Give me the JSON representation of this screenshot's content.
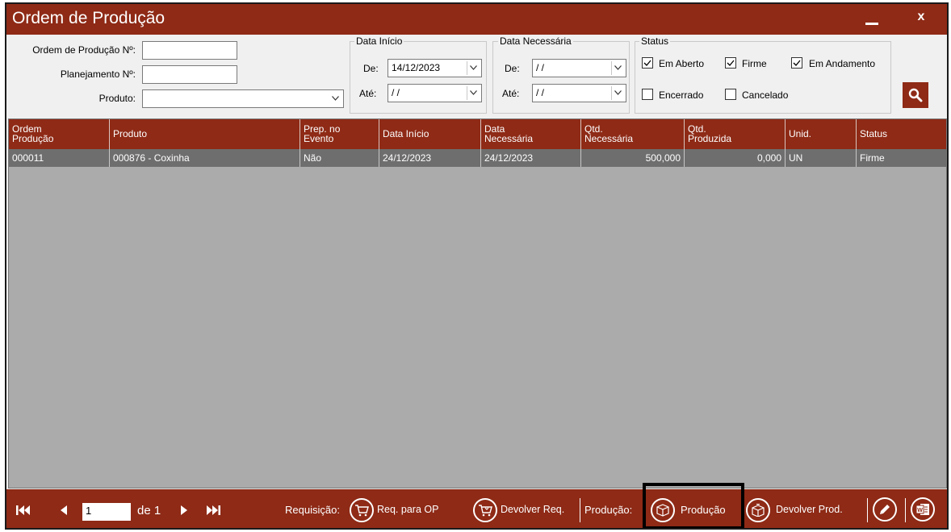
{
  "window": {
    "title": "Ordem de Produção",
    "minimize_label": "_",
    "close_label": "x"
  },
  "filters": {
    "ordem_label": "Ordem de Produção Nº:",
    "ordem_value": "",
    "planejamento_label": "Planejamento Nº:",
    "planejamento_value": "",
    "produto_label": "Produto:",
    "produto_value": "",
    "data_inicio": {
      "legend": "Data Início",
      "de_label": "De:",
      "de_value": "14/12/2023",
      "ate_label": "Até:",
      "ate_value": " / /"
    },
    "data_necessaria": {
      "legend": "Data Necessária",
      "de_label": "De:",
      "de_value": " / /",
      "ate_label": "Até:",
      "ate_value": " / /"
    },
    "status": {
      "legend": "Status",
      "options": [
        {
          "label": "Em Aberto",
          "checked": true
        },
        {
          "label": "Firme",
          "checked": true
        },
        {
          "label": "Em Andamento",
          "checked": true
        },
        {
          "label": "Encerrado",
          "checked": false
        },
        {
          "label": "Cancelado",
          "checked": false
        }
      ]
    },
    "search_icon": "magnifier-icon"
  },
  "grid": {
    "columns": [
      {
        "line1": "Ordem",
        "line2": "Produção"
      },
      {
        "line1": "Produto",
        "line2": ""
      },
      {
        "line1": "Prep. no",
        "line2": "Evento"
      },
      {
        "line1": "Data Início",
        "line2": ""
      },
      {
        "line1": "Data",
        "line2": "Necessária"
      },
      {
        "line1": "Qtd.",
        "line2": "Necessária"
      },
      {
        "line1": "Qtd.",
        "line2": "Produzida"
      },
      {
        "line1": "Unid.",
        "line2": ""
      },
      {
        "line1": "Status",
        "line2": ""
      }
    ],
    "rows": [
      [
        "000011",
        "000876 - Coxinha",
        "Não",
        "24/12/2023",
        "24/12/2023",
        "500,000",
        "0,000",
        "UN",
        "Firme"
      ]
    ]
  },
  "footer": {
    "page_value": "1",
    "page_of": "de 1",
    "requisicao_label": "Requisição:",
    "req_para_op": "Req. para OP",
    "devolver_req": "Devolver Req.",
    "producao_label": "Produção:",
    "producao_btn": "Produção",
    "devolver_prod": "Devolver Prod."
  },
  "colors": {
    "brand": "#8e2a16",
    "grid_bg": "#ababab",
    "selected_row": "#6e6e6e"
  }
}
